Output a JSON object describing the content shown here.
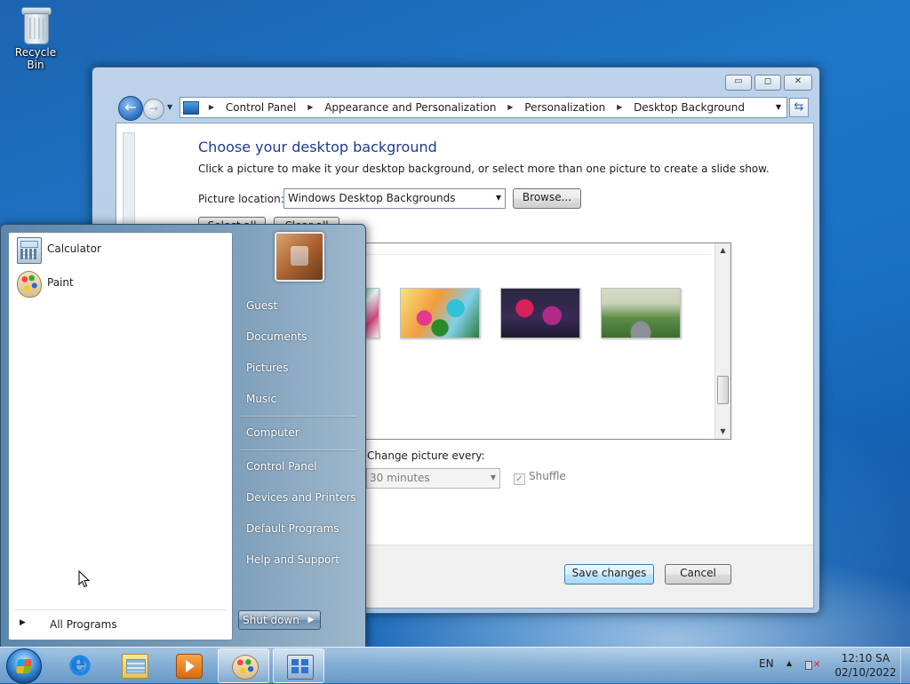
{
  "desktop": {
    "recycle_bin_label": "Recycle Bin"
  },
  "window": {
    "breadcrumb": [
      "Control Panel",
      "Appearance and Personalization",
      "Personalization",
      "Desktop Background"
    ],
    "title": "Choose your desktop background",
    "description": "Click a picture to make it your desktop background, or select more than one picture to create a slide show.",
    "picture_location_label": "Picture location:",
    "picture_location_value": "Windows Desktop Backgrounds",
    "browse_label": "Browse...",
    "select_all_label": "Select all",
    "clear_all_label": "Clear all",
    "change_every_label": "Change picture every:",
    "change_every_value": "30 minutes",
    "shuffle_label": "Shuffle",
    "save_label": "Save changes",
    "cancel_label": "Cancel",
    "controls": {
      "minimize": "▭",
      "maximize": "◻",
      "close": "✕"
    }
  },
  "start_menu": {
    "programs": [
      {
        "label": "Calculator",
        "icon": "calculator-icon"
      },
      {
        "label": "Paint",
        "icon": "paint-icon"
      }
    ],
    "all_programs_label": "All Programs",
    "right_items": [
      "Guest",
      "Documents",
      "Pictures",
      "Music",
      "Computer",
      "Control Panel",
      "Devices and Printers",
      "Default Programs",
      "Help and Support"
    ],
    "shutdown_label": "Shut down"
  },
  "taskbar": {
    "language": "EN",
    "time": "12:10 SA",
    "date": "02/10/2022",
    "pinned": [
      "internet-explorer-icon",
      "windows-explorer-icon",
      "media-player-icon",
      "paint-icon",
      "control-panel-icon"
    ]
  }
}
